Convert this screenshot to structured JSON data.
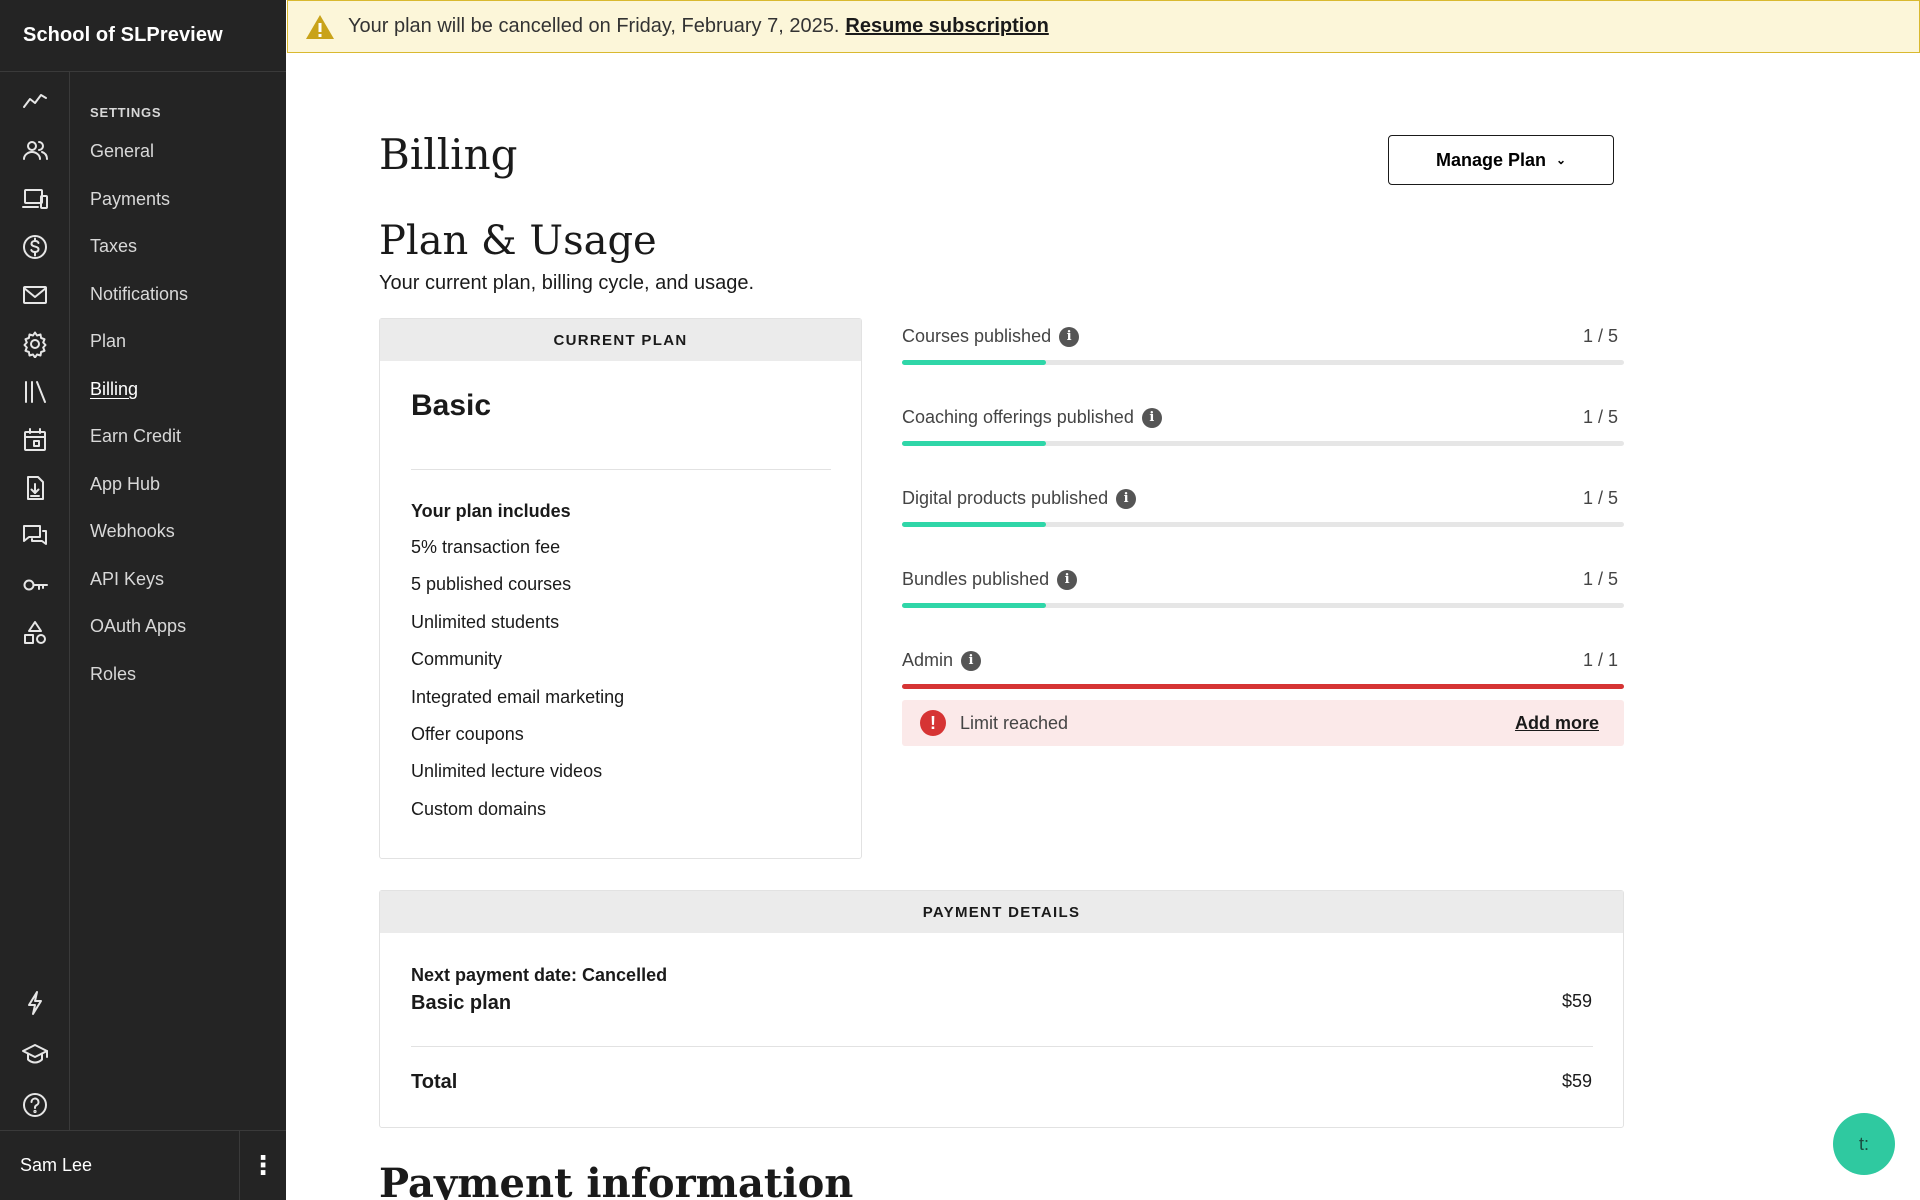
{
  "sidebar": {
    "school_name": "School of SLPreview",
    "settings_heading": "SETTINGS",
    "items": [
      {
        "label": "General"
      },
      {
        "label": "Payments"
      },
      {
        "label": "Taxes"
      },
      {
        "label": "Notifications"
      },
      {
        "label": "Plan"
      },
      {
        "label": "Billing",
        "active": true
      },
      {
        "label": "Earn Credit"
      },
      {
        "label": "App Hub"
      },
      {
        "label": "Webhooks"
      },
      {
        "label": "API Keys"
      },
      {
        "label": "OAuth Apps"
      },
      {
        "label": "Roles"
      }
    ],
    "rail_icons": [
      "analytics-icon",
      "users-icon",
      "devices-icon",
      "dollar-icon",
      "mail-icon",
      "gear-icon",
      "library-icon",
      "calendar-icon",
      "download-doc-icon",
      "chat-icon",
      "key-icon",
      "shapes-icon",
      "lightning-icon",
      "graduation-cap-icon",
      "help-icon"
    ],
    "user_name": "Sam Lee"
  },
  "banner": {
    "text": "Your plan will be cancelled on Friday, February 7, 2025.",
    "link": "Resume subscription",
    "color": "#fcf6d9"
  },
  "page": {
    "title": "Billing",
    "manage_plan_label": "Manage Plan",
    "section_title": "Plan & Usage",
    "section_subtitle": "Your current plan, billing cycle, and usage."
  },
  "current_plan": {
    "header": "CURRENT PLAN",
    "name": "Basic",
    "includes_title": "Your plan includes",
    "features": [
      "5% transaction fee",
      "5 published courses",
      "Unlimited students",
      "Community",
      "Integrated email marketing",
      "Offer coupons",
      "Unlimited lecture videos",
      "Custom domains"
    ]
  },
  "usage": [
    {
      "label": "Courses published",
      "value": "1 / 5",
      "fraction": 0.2
    },
    {
      "label": "Coaching offerings published",
      "value": "1 / 5",
      "fraction": 0.2
    },
    {
      "label": "Digital products published",
      "value": "1 / 5",
      "fraction": 0.2
    },
    {
      "label": "Bundles published",
      "value": "1 / 5",
      "fraction": 0.2
    },
    {
      "label": "Admin",
      "value": "1 / 1",
      "fraction": 1.0,
      "full": true
    }
  ],
  "limit": {
    "text": "Limit reached",
    "link": "Add more"
  },
  "payment_details": {
    "header": "PAYMENT DETAILS",
    "next_payment": "Next payment date: Cancelled",
    "plan_line": "Basic plan",
    "plan_price": "$59",
    "total_label": "Total",
    "total_price": "$59"
  },
  "payment_info_title": "Payment information",
  "chat_label": "t:",
  "colors": {
    "sidebar": "#242424",
    "accent_green": "#2fd6a8",
    "danger": "#d63434"
  }
}
